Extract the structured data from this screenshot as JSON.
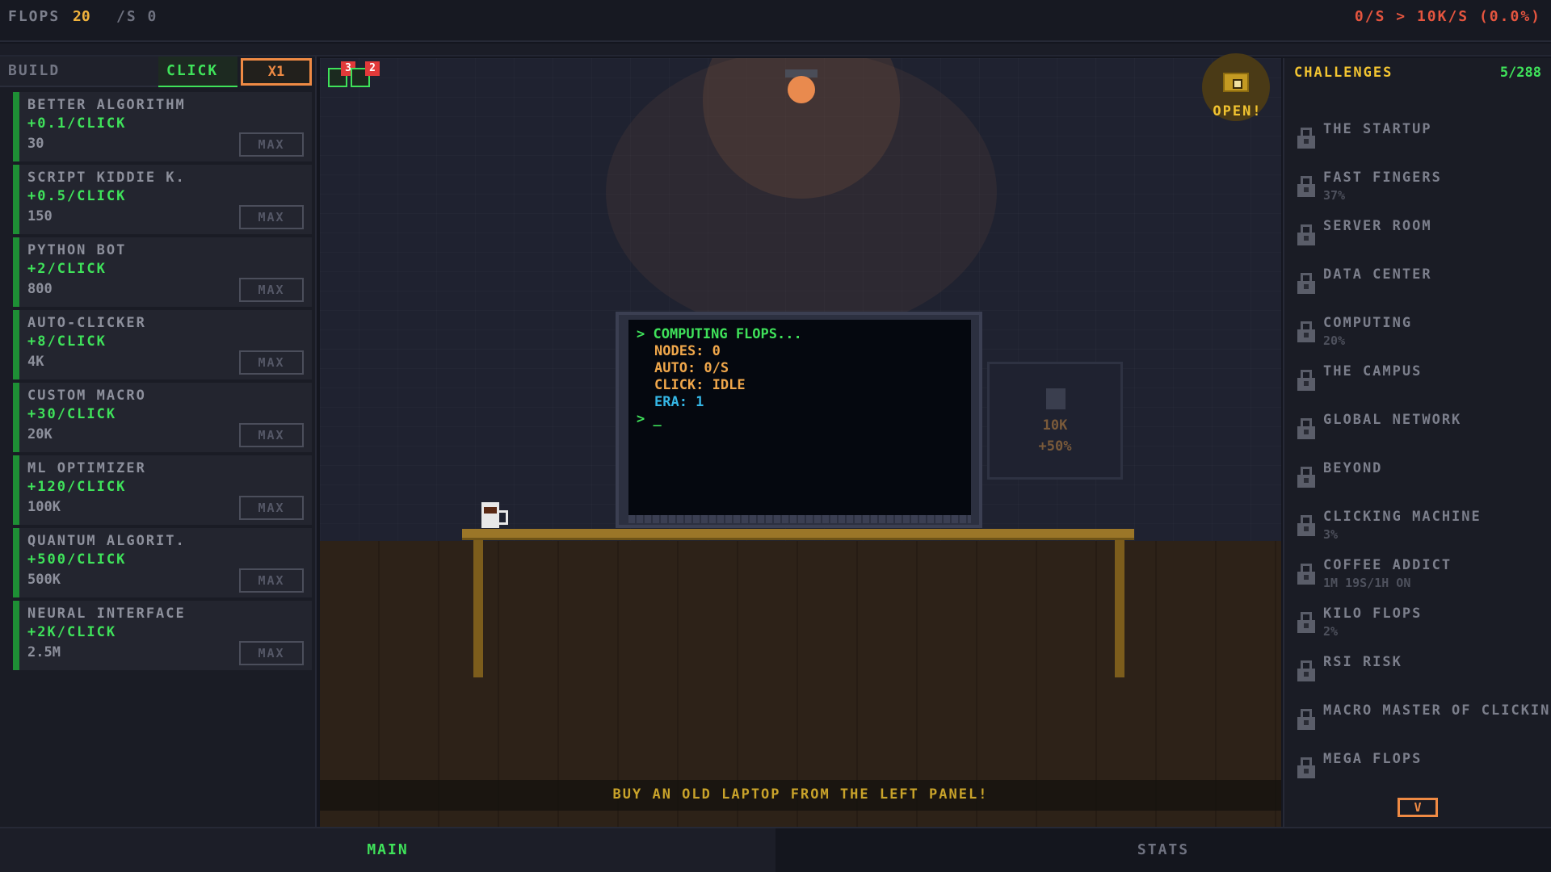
{
  "topbar": {
    "flops_label": "FLOPS",
    "flops_value": "20",
    "rate": "/S 0",
    "goal": "0/S > 10K/S (0.0%)"
  },
  "build_panel": {
    "tab_build": "BUILD",
    "tab_click": "CLICK",
    "multiplier": "X1",
    "upgrades": [
      {
        "name": "BETTER ALGORITHM",
        "gain": "+0.1/CLICK",
        "cost": "30",
        "max": "MAX"
      },
      {
        "name": "SCRIPT KIDDIE K.",
        "gain": "+0.5/CLICK",
        "cost": "150",
        "max": "MAX"
      },
      {
        "name": "PYTHON BOT",
        "gain": "+2/CLICK",
        "cost": "800",
        "max": "MAX"
      },
      {
        "name": "AUTO-CLICKER",
        "gain": "+8/CLICK",
        "cost": "4K",
        "max": "MAX"
      },
      {
        "name": "CUSTOM MACRO",
        "gain": "+30/CLICK",
        "cost": "20K",
        "max": "MAX"
      },
      {
        "name": "ML OPTIMIZER",
        "gain": "+120/CLICK",
        "cost": "100K",
        "max": "MAX"
      },
      {
        "name": "QUANTUM ALGORIT.",
        "gain": "+500/CLICK",
        "cost": "500K",
        "max": "MAX"
      },
      {
        "name": "NEURAL INTERFACE",
        "gain": "+2K/CLICK",
        "cost": "2.5M",
        "max": "MAX"
      }
    ]
  },
  "scene": {
    "badges": [
      "3",
      "2"
    ],
    "chest_label": "OPEN!",
    "terminal": {
      "line1": "> COMPUTING FLOPS...",
      "nodes": "NODES: 0",
      "auto": "AUTO: 0/S",
      "click": "CLICK: IDLE",
      "era": "ERA: 1",
      "prompt": "> _"
    },
    "ghost_cost": "10K",
    "ghost_bonus": "+50%",
    "hint": "BUY AN OLD LAPTOP FROM THE LEFT PANEL!"
  },
  "challenges": {
    "title": "CHALLENGES",
    "count": "5/288",
    "more": "V",
    "items": [
      {
        "name": "THE STARTUP",
        "progress": ""
      },
      {
        "name": "FAST FINGERS",
        "progress": "37%"
      },
      {
        "name": "SERVER ROOM",
        "progress": ""
      },
      {
        "name": "DATA CENTER",
        "progress": ""
      },
      {
        "name": "COMPUTING",
        "progress": "20%"
      },
      {
        "name": "THE CAMPUS",
        "progress": ""
      },
      {
        "name": "GLOBAL NETWORK",
        "progress": ""
      },
      {
        "name": "BEYOND",
        "progress": ""
      },
      {
        "name": "CLICKING MACHINE",
        "progress": "3%"
      },
      {
        "name": "COFFEE ADDICT",
        "progress": "1M 19S/1H ON"
      },
      {
        "name": "KILO FLOPS",
        "progress": "2%"
      },
      {
        "name": "RSI RISK",
        "progress": ""
      },
      {
        "name": "MACRO MASTER OF CLICKING",
        "progress": ""
      },
      {
        "name": "MEGA FLOPS",
        "progress": ""
      }
    ]
  },
  "nav": {
    "main": "MAIN",
    "stats": "STATS"
  },
  "colors": {
    "accent_green": "#3fe25a",
    "accent_orange": "#ef8a44",
    "accent_gold": "#f2c431",
    "accent_red": "#e5553f"
  }
}
